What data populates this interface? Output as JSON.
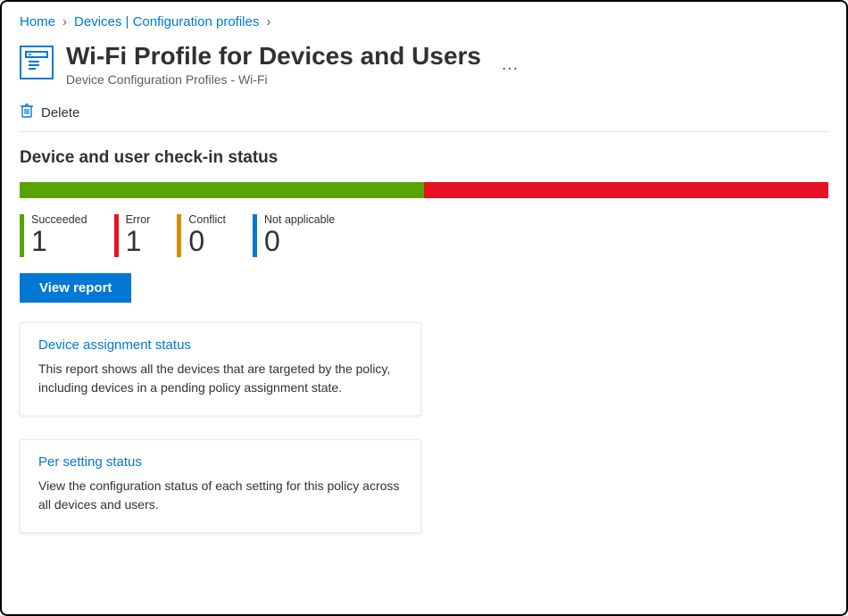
{
  "breadcrumb": {
    "items": [
      {
        "label": "Home"
      },
      {
        "label": "Devices | Configuration profiles"
      }
    ],
    "sep": "›"
  },
  "header": {
    "title": "Wi-Fi Profile for Devices and Users",
    "subtitle": "Device Configuration Profiles - Wi-Fi",
    "more": "…"
  },
  "toolbar": {
    "delete_label": "Delete"
  },
  "status": {
    "heading": "Device and user check-in status",
    "segments": {
      "green_pct": 50,
      "red_pct": 50
    },
    "stats": [
      {
        "label": "Succeeded",
        "value": "1",
        "color": "green"
      },
      {
        "label": "Error",
        "value": "1",
        "color": "red"
      },
      {
        "label": "Conflict",
        "value": "0",
        "color": "orange"
      },
      {
        "label": "Not applicable",
        "value": "0",
        "color": "blue"
      }
    ],
    "view_report": "View report"
  },
  "cards": [
    {
      "title": "Device assignment status",
      "body": "This report shows all the devices that are targeted by the policy, including devices in a pending policy assignment state."
    },
    {
      "title": "Per setting status",
      "body": "View the configuration status of each setting for this policy across all devices and users."
    }
  ],
  "chart_data": {
    "type": "bar",
    "title": "Device and user check-in status",
    "categories": [
      "Succeeded",
      "Error",
      "Conflict",
      "Not applicable"
    ],
    "values": [
      1,
      1,
      0,
      0
    ],
    "colors": [
      "#57a300",
      "#e81123",
      "#d18f00",
      "#0078d4"
    ]
  }
}
